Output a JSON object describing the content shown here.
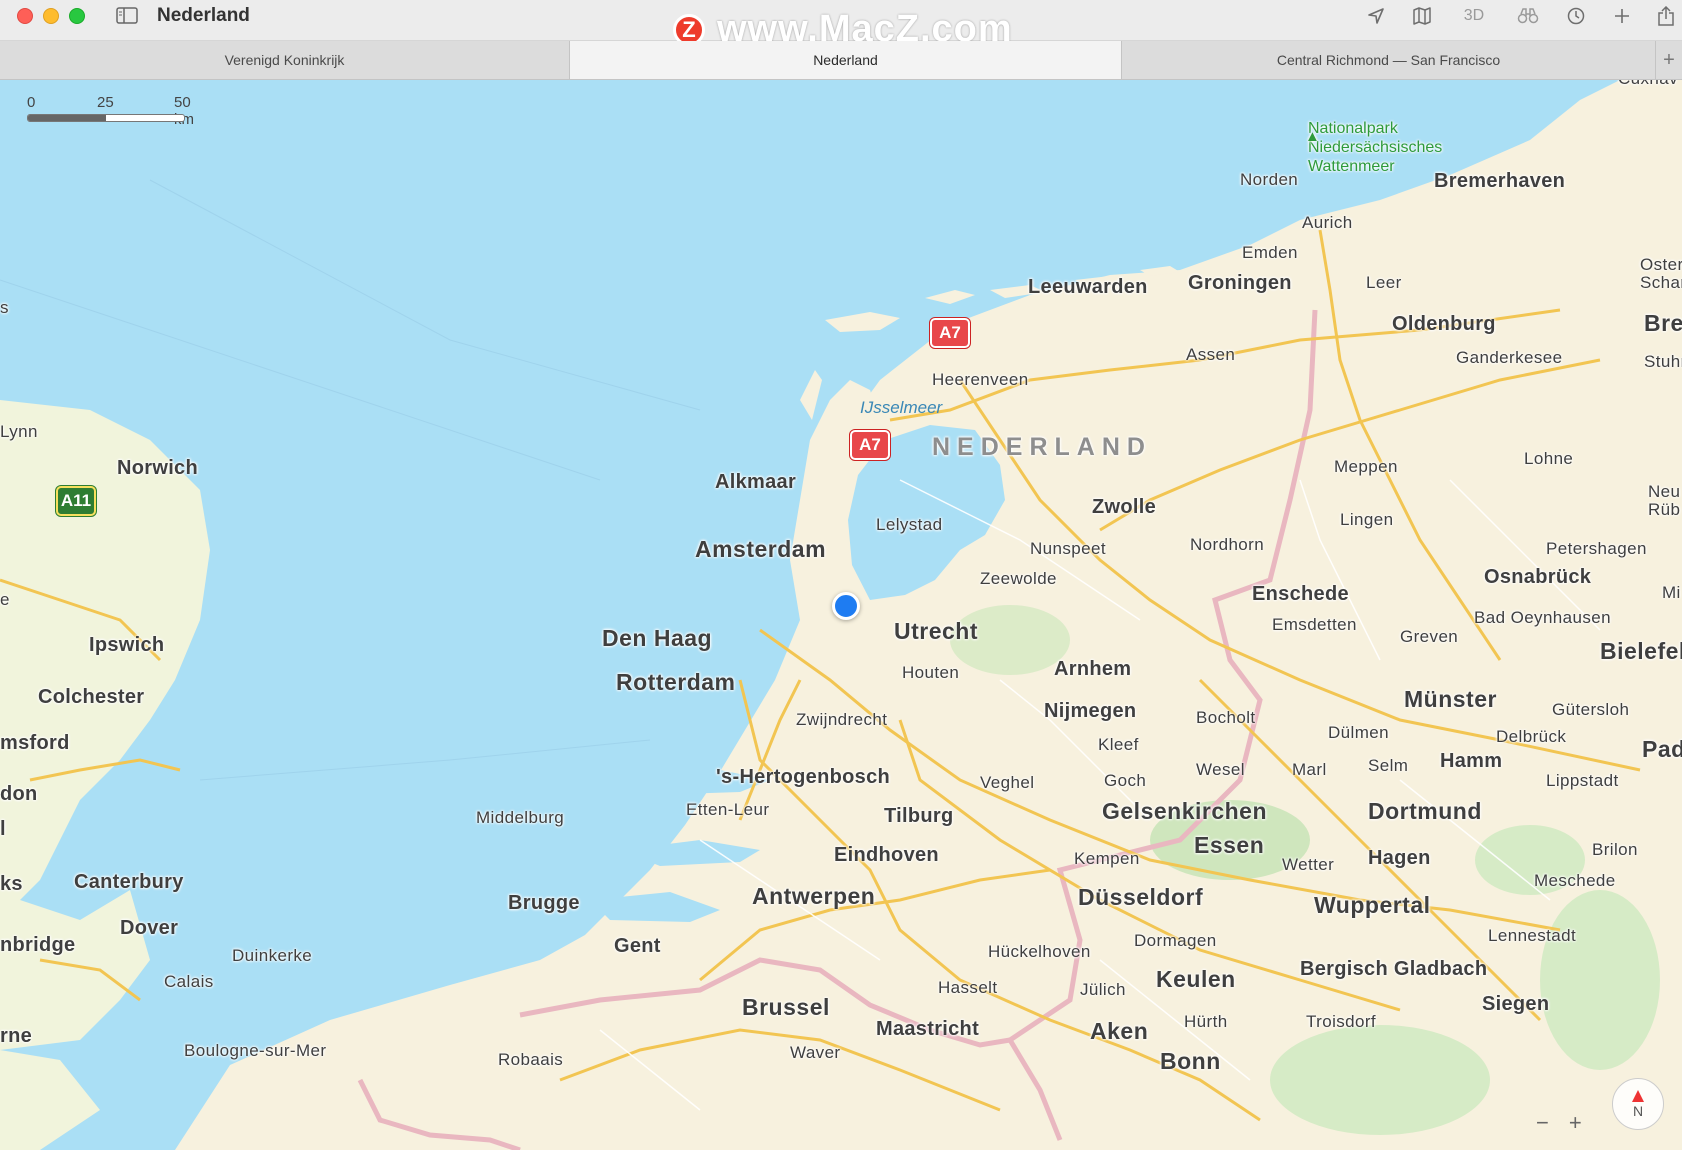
{
  "window": {
    "title": "Nederland",
    "toolbar_3d_label": "3D",
    "toolbar_icons": [
      "location-arrow-icon",
      "map-icon",
      "binoculars-icon",
      "clock-icon",
      "plus-icon",
      "share-icon"
    ]
  },
  "watermark": {
    "logo_text": "Z",
    "text": "www.MacZ.com"
  },
  "tabs": [
    {
      "label": "Verenigd Koninkrijk",
      "active": false
    },
    {
      "label": "Nederland",
      "active": true
    },
    {
      "label": "Central Richmond — San Francisco",
      "active": false
    }
  ],
  "tab_add_label": "+",
  "map": {
    "scale": {
      "t0": "0",
      "t1": "25",
      "t2": "50 km"
    },
    "country_label": "NEDERLAND",
    "water_label": "IJsselmeer",
    "park_label": [
      "Nationalpark",
      "Niedersächsisches",
      "Wattenmeer"
    ],
    "road_shields": [
      "A7",
      "A7",
      "A11"
    ],
    "cities": {
      "cuxhaven": "Cuxhav",
      "norden": "Norden",
      "bremerhaven": "Bremerhaven",
      "aurich": "Aurich",
      "emden": "Emden",
      "leeuwarden": "Leeuwarden",
      "groningen": "Groningen",
      "leer": "Leer",
      "oster": "Oster",
      "schar": "Schar",
      "oldenburg": "Oldenburg",
      "bre": "Bre",
      "assen": "Assen",
      "ganderkesee": "Ganderkesee",
      "stuhr": "Stuhr",
      "heerenveen": "Heerenveen",
      "meppen": "Meppen",
      "lohne": "Lohne",
      "alkmaar": "Alkmaar",
      "zwolle": "Zwolle",
      "neu": "Neu",
      "rub": "Rüb",
      "lelystad": "Lelystad",
      "lingen": "Lingen",
      "amsterdam": "Amsterdam",
      "nunspeet": "Nunspeet",
      "nordhorn": "Nordhorn",
      "petershagen": "Petershagen",
      "zeewolde": "Zeewolde",
      "osnabruck": "Osnabrück",
      "mi": "Mi",
      "enschede": "Enschede",
      "bad_oeynhausen": "Bad Oeynhausen",
      "den_haag": "Den Haag",
      "utrecht": "Utrecht",
      "emsdetten": "Emsdetten",
      "greven": "Greven",
      "bielefeld": "Bielefel",
      "houten": "Houten",
      "arnhem": "Arnhem",
      "rotterdam": "Rotterdam",
      "munster": "Münster",
      "nijmegen": "Nijmegen",
      "bocholt": "Bocholt",
      "gutersloh": "Gütersloh",
      "zwijndrecht": "Zwijndrecht",
      "dulmen": "Dülmen",
      "kleef": "Kleef",
      "delbruck": "Delbrück",
      "pade": "Pade",
      "hertogenbosch": "'s-Hertogenbosch",
      "wesel": "Wesel",
      "marl": "Marl",
      "selm": "Selm",
      "hamm": "Hamm",
      "veghel": "Veghel",
      "goch": "Goch",
      "lippstadt": "Lippstadt",
      "etten_leur": "Etten-Leur",
      "middelburg": "Middelburg",
      "tilburg": "Tilburg",
      "gelsenkirchen": "Gelsenkirchen",
      "dortmund": "Dortmund",
      "eindhoven": "Eindhoven",
      "kempen": "Kempen",
      "essen": "Essen",
      "brilon": "Brilon",
      "wetter": "Wetter",
      "hagen": "Hagen",
      "meschede": "Meschede",
      "antwerpen": "Antwerpen",
      "dusseldorf": "Düsseldorf",
      "brugge": "Brugge",
      "wuppertal": "Wuppertal",
      "lennestadt": "Lennestadt",
      "dormagen": "Dormagen",
      "gent": "Gent",
      "huckelhoven": "Hückelhoven",
      "bergisch_gladbach": "Bergisch Gladbach",
      "duinkerke": "Duinkerke",
      "keulen": "Keulen",
      "calais": "Calais",
      "hasselt": "Hasselt",
      "julich": "Jülich",
      "siegen": "Siegen",
      "brussel": "Brussel",
      "maastricht": "Maastricht",
      "aken": "Aken",
      "hurth": "Hürth",
      "troisdorf": "Troisdorf",
      "boulogne": "Boulogne-sur-Mer",
      "robaais": "Robaais",
      "waver": "Waver",
      "bonn": "Bonn",
      "norwich": "Norwich",
      "lynn": "Lynn",
      "s_frag": "s",
      "ipswich": "Ipswich",
      "colchester": "Colchester",
      "chelmsford": "msford",
      "london": "don",
      "l_frag": "l",
      "canterbury": "Canterbury",
      "ks_frag": "ks",
      "dover": "Dover",
      "tunbridge": "nbridge",
      "eastbourne": "rne",
      "e_frag": "e"
    },
    "compass_label": "N",
    "zoom_out": "−",
    "zoom_in": "+"
  }
}
